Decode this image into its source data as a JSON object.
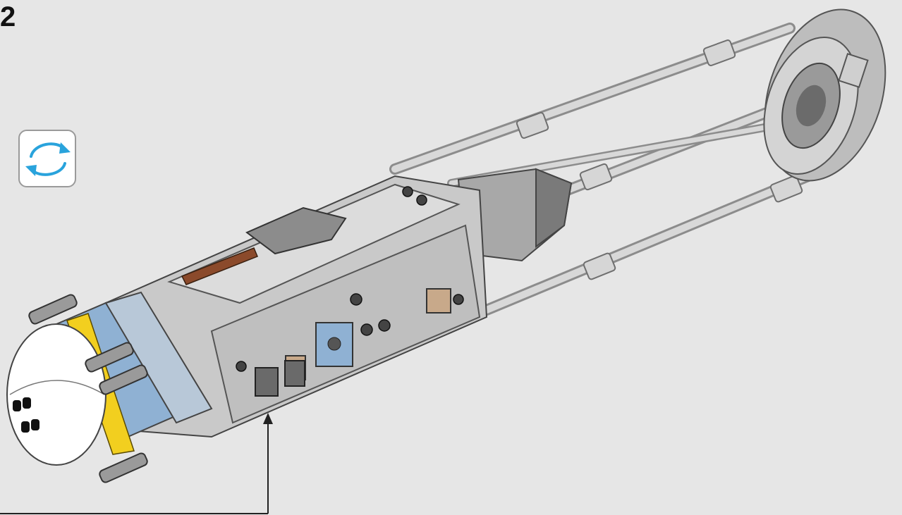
{
  "step": {
    "number": "2"
  },
  "rotate_indicator": {
    "icon": "rotate-icon",
    "color": "#29a3dc"
  },
  "model": {
    "description_icon": "y-wing-engine-assembly"
  },
  "colors": {
    "background": "#e6e6e6",
    "accent_blue": "#8fb1d3",
    "accent_yellow": "#f2cf1f",
    "accent_tan": "#c8a98a",
    "accent_brown": "#8b4a2b",
    "light_gray": "#cfcfcf",
    "dark_gray": "#8c8c8c"
  }
}
